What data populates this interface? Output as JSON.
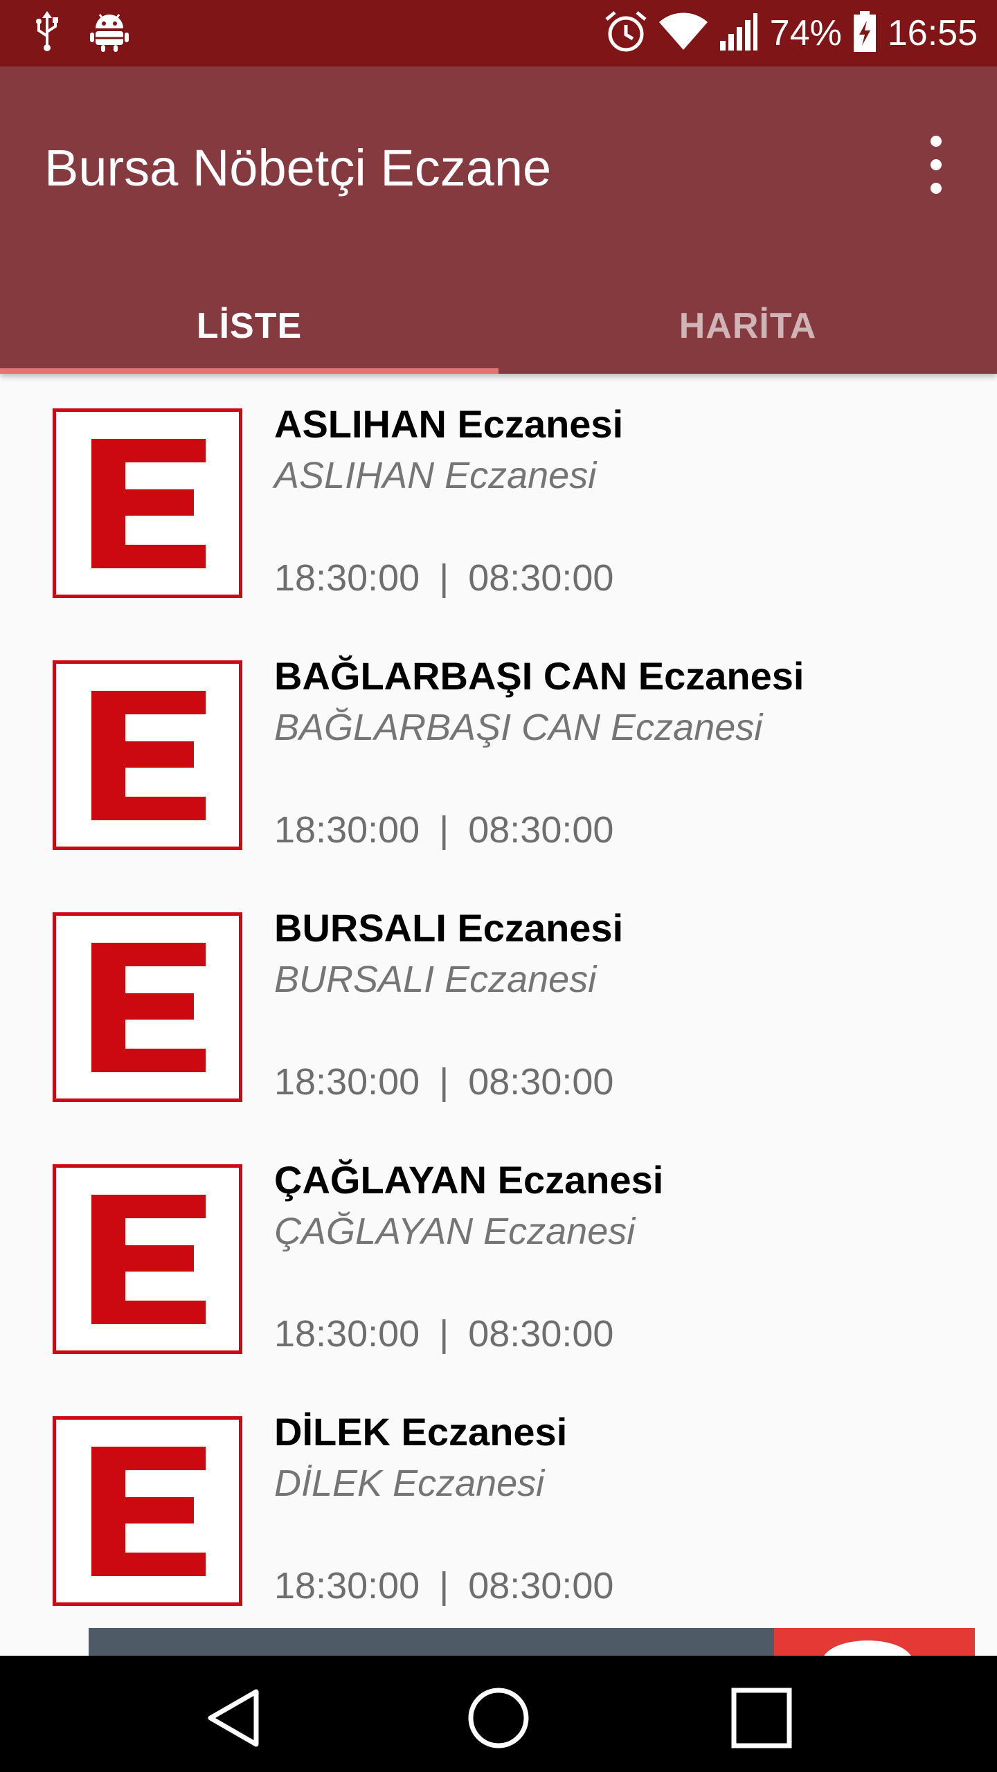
{
  "status_bar": {
    "battery": "74%",
    "time": "16:55",
    "icons": [
      "usb-icon",
      "android-debug-icon",
      "alarm-icon",
      "wifi-icon",
      "signal-icon",
      "battery-charging-icon"
    ]
  },
  "app_bar": {
    "title": "Bursa Nöbetçi Eczane",
    "menu_icon": "overflow-menu-icon"
  },
  "tabs": [
    {
      "label": "LİSTE",
      "selected": true
    },
    {
      "label": "HARİTA",
      "selected": false
    }
  ],
  "pharmacies": [
    {
      "name": "ASLIHAN Eczanesi",
      "subtitle": "ASLIHAN Eczanesi",
      "open": "18:30:00",
      "close": "08:30:00",
      "separator": "|"
    },
    {
      "name": "BAĞLARBAŞI CAN Eczanesi",
      "subtitle": "BAĞLARBAŞI CAN Eczanesi",
      "open": "18:30:00",
      "close": "08:30:00",
      "separator": "|"
    },
    {
      "name": "BURSALI Eczanesi",
      "subtitle": "BURSALI Eczanesi",
      "open": "18:30:00",
      "close": "08:30:00",
      "separator": "|"
    },
    {
      "name": "ÇAĞLAYAN Eczanesi",
      "subtitle": "ÇAĞLAYAN Eczanesi",
      "open": "18:30:00",
      "close": "08:30:00",
      "separator": "|"
    },
    {
      "name": "DİLEK Eczanesi",
      "subtitle": "DİLEK Eczanesi",
      "open": "18:30:00",
      "close": "08:30:00",
      "separator": "|"
    }
  ],
  "nav_bar": {
    "icons": [
      "back-icon",
      "home-icon",
      "recents-icon"
    ]
  },
  "colors": {
    "status_bar": "#801517",
    "app_bar": "#853a3f",
    "tab_indicator": "#e57373",
    "pharmacy_red": "#cc0810"
  }
}
